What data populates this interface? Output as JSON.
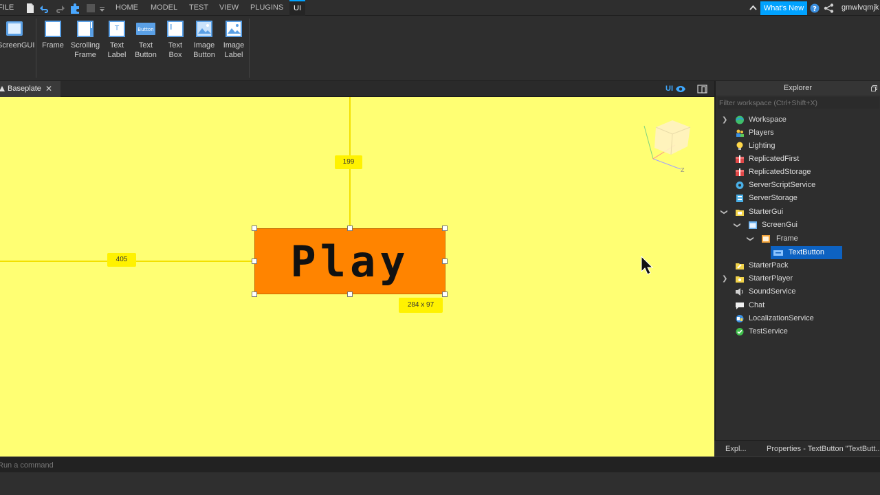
{
  "menubar": {
    "file_label": "FILE",
    "tabs": [
      "HOME",
      "MODEL",
      "TEST",
      "VIEW",
      "PLUGINS",
      "UI"
    ],
    "active_tab": "UI",
    "whats_new": "What's New",
    "username": "gmwlvqmjk"
  },
  "ribbon": {
    "screen_gui": "ScreenGUI",
    "items": [
      {
        "label": "Frame",
        "icon": "frame-icon"
      },
      {
        "label": "Scrolling Frame",
        "icon": "scrolling-frame-icon"
      },
      {
        "label": "Text Label",
        "icon": "text-label-icon"
      },
      {
        "label": "Text Button",
        "icon": "text-button-icon",
        "icon_text": "Button"
      },
      {
        "label": "Text Box",
        "icon": "text-box-icon"
      },
      {
        "label": "Image Button",
        "icon": "image-button-icon"
      },
      {
        "label": "Image Label",
        "icon": "image-label-icon"
      }
    ]
  },
  "viewport": {
    "tab_label": "Baseplate",
    "ui_toggle": "UI",
    "background_color": "#ffff73",
    "button_text": "Play",
    "button_color": "#ff8400",
    "distance_top": "199",
    "distance_left": "405",
    "size_label": "284 x 97"
  },
  "explorer": {
    "title": "Explorer",
    "filter_placeholder": "Filter workspace (Ctrl+Shift+X)",
    "items": [
      {
        "label": "Workspace",
        "icon": "workspace-icon",
        "expand": "collapsed"
      },
      {
        "label": "Players",
        "icon": "players-icon"
      },
      {
        "label": "Lighting",
        "icon": "lighting-icon"
      },
      {
        "label": "ReplicatedFirst",
        "icon": "replicated-first-icon"
      },
      {
        "label": "ReplicatedStorage",
        "icon": "replicated-storage-icon"
      },
      {
        "label": "ServerScriptService",
        "icon": "server-script-service-icon"
      },
      {
        "label": "ServerStorage",
        "icon": "server-storage-icon"
      },
      {
        "label": "StarterGui",
        "icon": "starter-gui-icon",
        "expand": "expanded"
      },
      {
        "label": "ScreenGui",
        "icon": "screen-gui-icon",
        "expand": "expanded"
      },
      {
        "label": "Frame",
        "icon": "frame-icon",
        "expand": "expanded"
      },
      {
        "label": "TextButton",
        "icon": "text-button-icon",
        "selected": true
      },
      {
        "label": "StarterPack",
        "icon": "starter-pack-icon"
      },
      {
        "label": "StarterPlayer",
        "icon": "starter-player-icon",
        "expand": "collapsed"
      },
      {
        "label": "SoundService",
        "icon": "sound-service-icon"
      },
      {
        "label": "Chat",
        "icon": "chat-icon"
      },
      {
        "label": "LocalizationService",
        "icon": "localization-service-icon"
      },
      {
        "label": "TestService",
        "icon": "test-service-icon"
      }
    ]
  },
  "panel_tabs": {
    "explorer": "Expl...",
    "properties": "Properties - TextButton \"TextButt..."
  },
  "command_bar": {
    "placeholder": "Run a command"
  },
  "colors": {
    "accent": "#00a2ff",
    "selection": "#0d62c2"
  }
}
